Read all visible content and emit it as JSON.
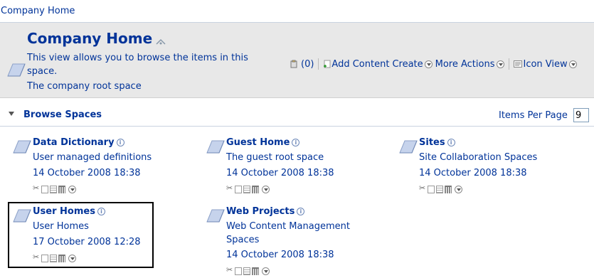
{
  "breadcrumb": {
    "label": "Company Home"
  },
  "header": {
    "title": "Company Home",
    "description": "This view allows you to browse the items in this space.",
    "root_description": "The company root space"
  },
  "actions": {
    "clipboard_count": "(0)",
    "add_content": "Add Content",
    "create": "Create",
    "more_actions": "More Actions",
    "icon_view": "Icon View"
  },
  "browse": {
    "title": "Browse Spaces",
    "items_per_page_label": "Items Per Page",
    "items_per_page_value": "9"
  },
  "spaces": [
    {
      "name": "Data Dictionary",
      "description": "User managed definitions",
      "date": "14 October 2008 18:38"
    },
    {
      "name": "Guest Home",
      "description": "The guest root space",
      "date": "14 October 2008 18:38"
    },
    {
      "name": "Sites",
      "description": "Site Collaboration Spaces",
      "date": "14 October 2008 18:38"
    },
    {
      "name": "User Homes",
      "description": "User Homes",
      "date": "17 October 2008 12:28"
    },
    {
      "name": "Web Projects",
      "description_line1": "Web Content Management",
      "description_line2": "Spaces",
      "date": "14 October 2008 18:38"
    }
  ],
  "colors": {
    "link": "#003399",
    "header_bg": "#e8e8e8"
  }
}
